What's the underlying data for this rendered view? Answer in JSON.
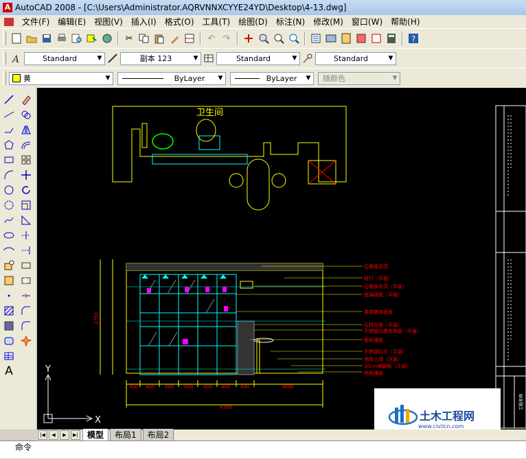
{
  "window": {
    "title": "AutoCAD 2008 - [C:\\Users\\Administrator.AQRVNNXCYYE24YD\\Desktop\\4-13.dwg]"
  },
  "menu": {
    "items": [
      "文件(F)",
      "编辑(E)",
      "视图(V)",
      "插入(I)",
      "格式(O)",
      "工具(T)",
      "绘图(D)",
      "标注(N)",
      "修改(M)",
      "窗口(W)",
      "帮助(H)"
    ]
  },
  "styles_toolbar": {
    "text_style": "Standard",
    "dim_style": "副本 123",
    "table_style": "Standard",
    "multileader_style": "Standard"
  },
  "properties_toolbar": {
    "layer": "黄",
    "layer_color": "#ffff00",
    "linetype": "ByLayer",
    "lineweight": "ByLayer",
    "plot_style": "随颜色"
  },
  "drawing": {
    "plan_title": "卫生间",
    "annotations": [
      "石膏板吊顶",
      "射灯（平装）",
      "石膏板吊顶（平装）",
      "玻璃隔板（平装）",
      "单钢做体面板",
      "石材台面（平装）",
      "不锈钢马赛克饰面（平装）",
      "面砖铺装",
      "不锈钢拉手（平装）",
      "地砖上墙（平装）",
      "10cm踢脚板（平装）",
      "地面铺装"
    ],
    "annotation_color": "#ff0000",
    "dimensions_bottom": [
      "400",
      "400",
      "400",
      "400",
      "400",
      "400",
      "440",
      "3690"
    ],
    "dimension_total": "4790",
    "dimension_height": "2750",
    "axis_x": "X",
    "axis_y": "Y",
    "title_block_label": "工程名称"
  },
  "layout_tabs": [
    "模型",
    "布局1",
    "布局2"
  ],
  "command_line": {
    "prompt": "命令"
  },
  "watermark": {
    "name": "土木工程网",
    "url": "www.civilcn.com"
  }
}
